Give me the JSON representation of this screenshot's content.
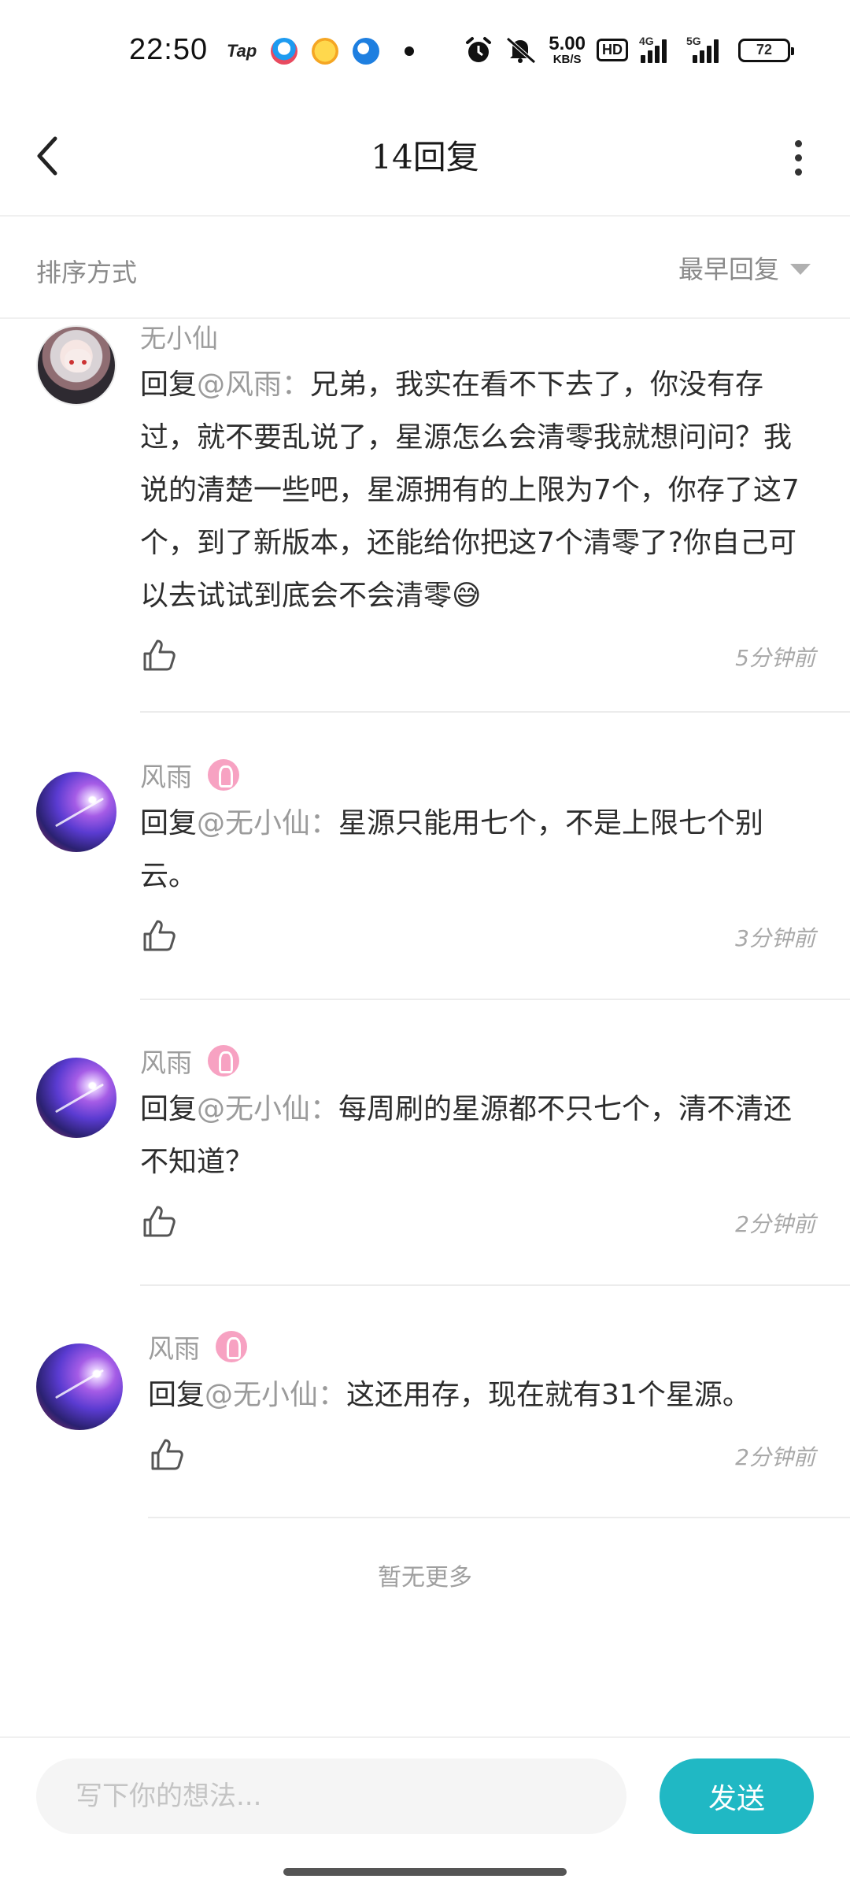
{
  "status_bar": {
    "time": "22:50",
    "tap_label": "Tap",
    "net_speed_value": "5.00",
    "net_speed_unit": "KB/S",
    "hd_label": "HD",
    "signal1_label": "4G",
    "signal2_label": "5G",
    "battery": "72",
    "icons": [
      "tap-icon",
      "qq-icon",
      "game-icon",
      "browser-icon",
      "dot-icon",
      "alarm-icon",
      "mute-icon",
      "hd-icon",
      "signal-4g-icon",
      "signal-5g-icon",
      "battery-icon"
    ]
  },
  "header": {
    "title": "14回复",
    "back_icon": "chevron-left-icon",
    "more_icon": "more-vertical-icon"
  },
  "sort_bar": {
    "label": "排序方式",
    "selected": "最早回复"
  },
  "replies": [
    {
      "username": "无小仙",
      "has_badge": false,
      "prefix": "回复",
      "mention": "@风雨：",
      "content": "兄弟，我实在看不下去了，你没有存过，就不要乱说了，星源怎么会清零我就想问问？我说的清楚一些吧，星源拥有的上限为7个，你存了这7个，到了新版本，还能给你把这7个清零了?你自己可以去试试到底会不会清零😅",
      "time": "5分钟前"
    },
    {
      "username": "风雨",
      "has_badge": true,
      "prefix": "回复",
      "mention": "@无小仙：",
      "content": "星源只能用七个，不是上限七个别云。",
      "time": "3分钟前"
    },
    {
      "username": "风雨",
      "has_badge": true,
      "prefix": "回复",
      "mention": "@无小仙：",
      "content": "每周刷的星源都不只七个，清不清还不知道？",
      "time": "2分钟前"
    },
    {
      "username": "风雨",
      "has_badge": true,
      "prefix": "回复",
      "mention": "@无小仙：",
      "content": "这还用存，现在就有31个星源。",
      "time": "2分钟前"
    }
  ],
  "no_more": "暂无更多",
  "composer": {
    "placeholder": "写下你的想法...",
    "value": "",
    "send_label": "发送"
  },
  "colors": {
    "accent": "#20b8c4",
    "badge": "#f7a2c2",
    "muted_text": "#9c9c9c"
  }
}
